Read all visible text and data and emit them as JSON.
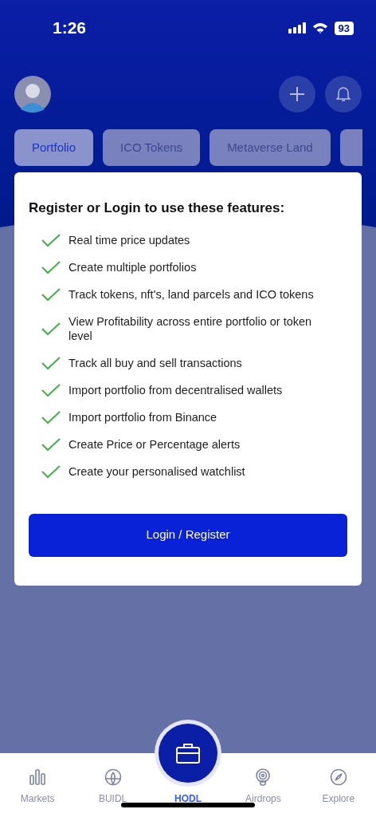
{
  "status_bar": {
    "time": "1:26",
    "battery": "93"
  },
  "tabs": [
    {
      "label": "Portfolio",
      "selected": true
    },
    {
      "label": "ICO Tokens",
      "selected": false
    },
    {
      "label": "Metaverse Land",
      "selected": false
    }
  ],
  "card": {
    "title": "Register or Login to use these features:",
    "features": [
      "Real time price updates",
      "Create multiple portfolios",
      "Track tokens, nft's, land parcels and ICO tokens",
      "View Profitability across entire portfolio or token level",
      "Track all buy and sell transactions",
      "Import portfolio from decentralised wallets",
      "Import portfolio from Binance",
      "Create Price or Percentage alerts",
      "Create your personalised watchlist"
    ],
    "button": "Login / Register"
  },
  "bottom_nav": [
    {
      "label": "Markets",
      "kind": "bars",
      "selected": false
    },
    {
      "label": "BUIDL",
      "kind": "globe",
      "selected": false
    },
    {
      "label": "HODL",
      "kind": "briefcase",
      "selected": true
    },
    {
      "label": "Airdrops",
      "kind": "signal",
      "selected": false
    },
    {
      "label": "Explore",
      "kind": "compass",
      "selected": false
    }
  ]
}
